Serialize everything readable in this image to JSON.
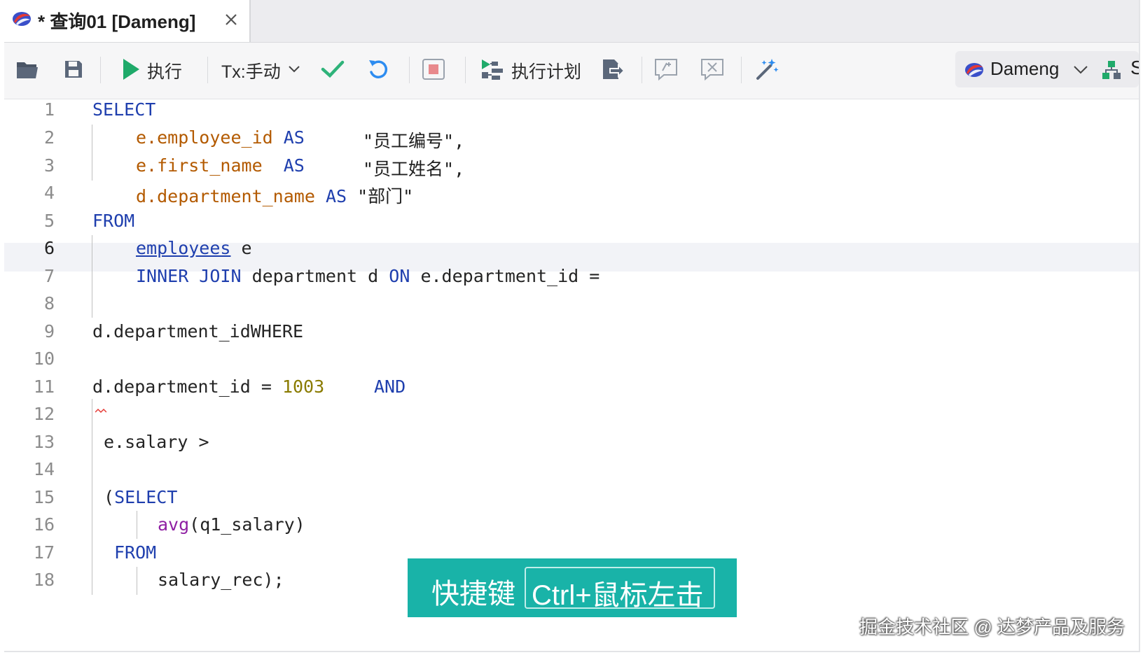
{
  "tab": {
    "title": "* 查询01 [Dameng]",
    "logo_icon": "dameng-logo-icon",
    "close_icon": "close-icon"
  },
  "toolbar": {
    "open_icon": "folder-open-icon",
    "save_icon": "save-icon",
    "execute_label": "执行",
    "tx_label": "Tx:手动",
    "commit_icon": "check-icon",
    "rollback_icon": "undo-icon",
    "stop_icon": "stop-icon",
    "plan_label": "执行计划",
    "export_icon": "export-icon",
    "comment_icon": "comment-icon",
    "uncomment_icon": "uncomment-icon",
    "format_icon": "magic-wand-icon",
    "connection_label": "Dameng",
    "schema_icon": "schema-icon",
    "schema_label_partial": "S"
  },
  "editor": {
    "current_line": 6,
    "line_numbers": [
      "1",
      "2",
      "3",
      "4",
      "5",
      "6",
      "7",
      "8",
      "9",
      "10",
      "11",
      "12",
      "13",
      "14",
      "15",
      "16",
      "17",
      "18"
    ],
    "lines": {
      "l1": [
        "SELECT"
      ],
      "l2": [
        "e.employee_id",
        "AS",
        "\"员工编号\","
      ],
      "l3": [
        "e.first_name",
        "AS",
        "\"员工姓名\","
      ],
      "l4": [
        "d.department_name",
        "AS",
        "\"部门\""
      ],
      "l5": [
        "FROM"
      ],
      "l6": [
        "employees",
        "e"
      ],
      "l7": [
        "INNER JOIN",
        "department d",
        "ON",
        "e.department_id ="
      ],
      "l9": [
        "d.department_idWHERE"
      ],
      "l11": [
        "d.department_id =",
        "1003",
        "AND"
      ],
      "l13": [
        "e.salary >"
      ],
      "l15": [
        "(",
        "SELECT"
      ],
      "l16": [
        "avg",
        "(q1_salary)"
      ],
      "l17": [
        "FROM"
      ],
      "l18": [
        "salary_rec);"
      ]
    }
  },
  "overlay": {
    "shortcut_label": "快捷键",
    "shortcut_key": "Ctrl+鼠标左击"
  },
  "watermark": "掘金技术社区 @ 达梦产品及服务",
  "colors": {
    "keyword": "#1f3fae",
    "field": "#b35a00",
    "number": "#8a7b00",
    "function": "#8f1fa3",
    "run_green": "#1faa6a",
    "overlay_teal": "#19b3a8"
  }
}
